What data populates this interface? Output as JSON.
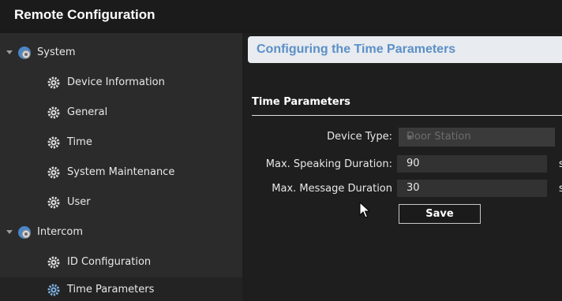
{
  "window": {
    "title": "Remote Configuration"
  },
  "sidebar": {
    "groups": [
      {
        "label": "System",
        "items": [
          "Device Information",
          "General",
          "Time",
          "System Maintenance",
          "User"
        ]
      },
      {
        "label": "Intercom",
        "items": [
          "ID Configuration",
          "Time Parameters"
        ]
      }
    ],
    "selected": "Time Parameters"
  },
  "main": {
    "header": "Configuring the Time Parameters",
    "section_title": "Time Parameters",
    "fields": {
      "device_type": {
        "label": "Device Type:",
        "value": "Door Station"
      },
      "max_speaking": {
        "label": "Max. Speaking Duration:",
        "value": "90",
        "unit": "s"
      },
      "max_message": {
        "label": "Max. Message Duration",
        "value": "30",
        "unit": "s"
      }
    },
    "save_label": "Save"
  },
  "colors": {
    "header_text": "#5b8fc7",
    "header_bg": "#e8ebef",
    "sidebar_bg": "#2b2b2b"
  }
}
